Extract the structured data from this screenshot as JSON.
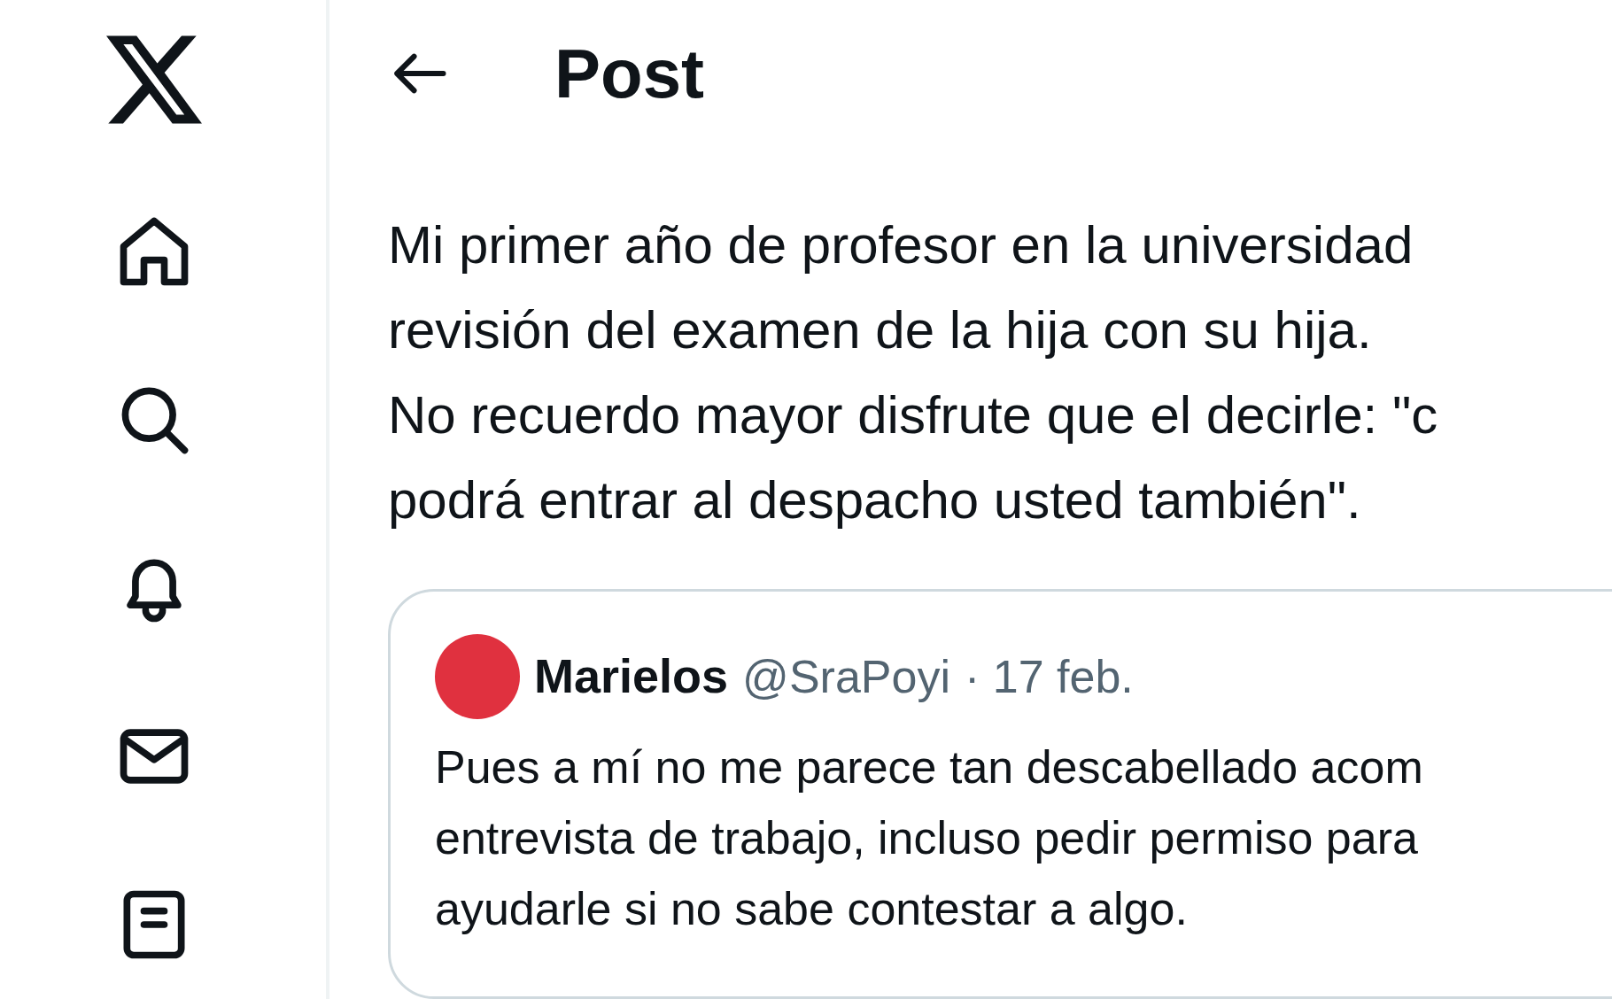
{
  "sidebar": {
    "items": [
      {
        "kind": "home"
      },
      {
        "kind": "search"
      },
      {
        "kind": "bell"
      },
      {
        "kind": "mail"
      },
      {
        "kind": "list"
      }
    ]
  },
  "header": {
    "title": "Post"
  },
  "post": {
    "lines": [
      "Mi primer año de profesor en la universidad",
      "revisión del examen de la hija con su hija.",
      "No recuerdo mayor disfrute que el decirle: \"c",
      "podrá entrar al despacho usted también\"."
    ]
  },
  "quote": {
    "name": "Marielos",
    "handle": "@SraPoyi",
    "date": "· 17 feb.",
    "lines": [
      "Pues a mí no me parece tan descabellado acom",
      "entrevista de trabajo, incluso pedir permiso para",
      "ayudarle si no sabe contestar a algo."
    ]
  }
}
